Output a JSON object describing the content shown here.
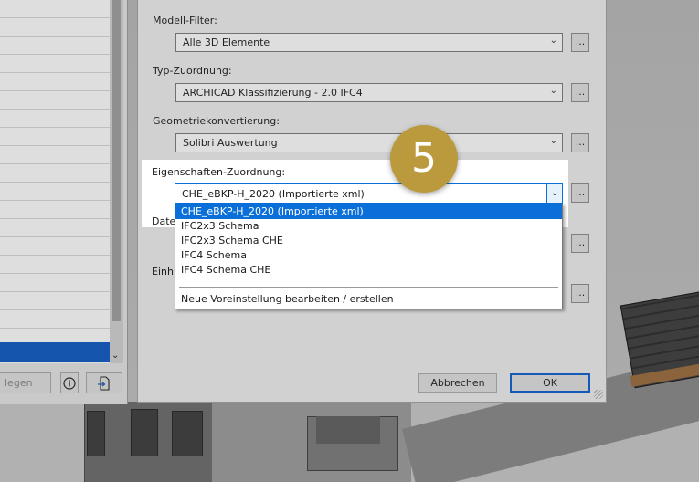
{
  "dialog": {
    "model_filter": {
      "label": "Modell-Filter:",
      "value": "Alle 3D Elemente"
    },
    "type_mapping": {
      "label": "Typ-Zuordnung:",
      "value": "ARCHICAD Klassifizierung - 2.0 IFC4"
    },
    "geometry_conversion": {
      "label": "Geometriekonvertierung:",
      "value": "Solibri Auswertung"
    },
    "property_mapping": {
      "label": "Eigenschaften-Zuordnung:",
      "value": "CHE_eBKP-H_2020 (Importierte xml)",
      "options": [
        "CHE_eBKP-H_2020 (Importierte xml)",
        "IFC2x3 Schema",
        "IFC2x3 Schema CHE",
        "IFC4 Schema",
        "IFC4 Schema CHE"
      ],
      "edit_option": "Neue Voreinstellung bearbeiten / erstellen"
    },
    "partial_label_1": "Date",
    "partial_label_2": "Einh",
    "dots_label": "...",
    "cancel_label": "Abbrechen",
    "ok_label": "OK"
  },
  "left_panel": {
    "partial_button": "legen"
  },
  "step_badge": "5",
  "colors": {
    "selection": "#0a6fd8",
    "badge": "#ba9a3c"
  }
}
